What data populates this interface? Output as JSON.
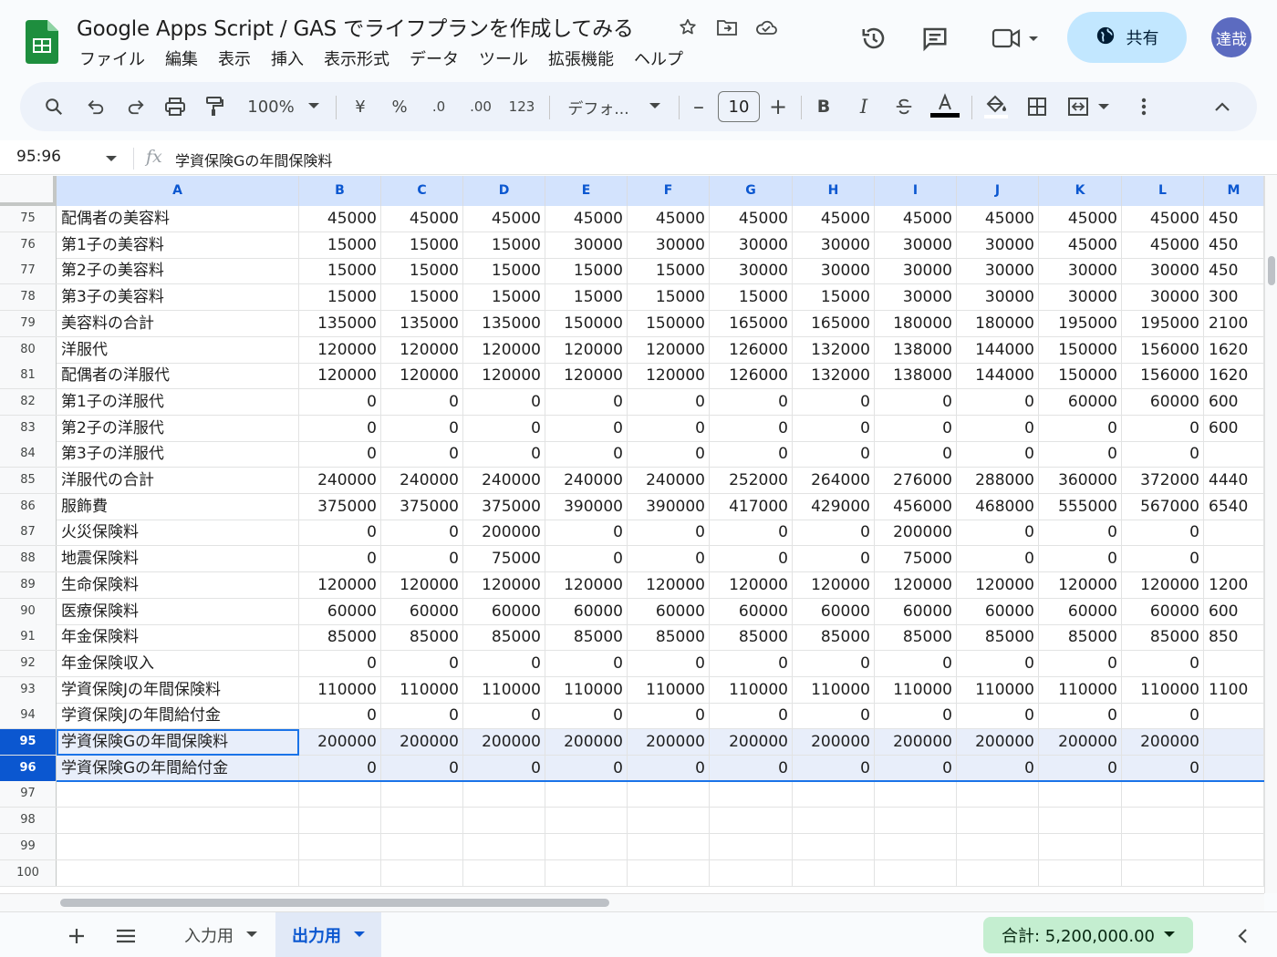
{
  "doc": {
    "title": "Google Apps Script / GAS でライフプランを作成してみる",
    "menu": [
      "ファイル",
      "編集",
      "表示",
      "挿入",
      "表示形式",
      "データ",
      "ツール",
      "拡張機能",
      "ヘルプ"
    ],
    "share_label": "共有",
    "avatar_text": "達哉"
  },
  "toolbar": {
    "zoom": "100%",
    "currency": "¥",
    "percent": "%",
    "dec_minus": ".0",
    "dec_plus": ".00",
    "format_123": "123",
    "font": "デフォ...",
    "font_size": "10"
  },
  "formula_bar": {
    "name_box": "95:96",
    "fx": "fx",
    "content": "学資保険Gの年間保険料"
  },
  "grid": {
    "columns": [
      "A",
      "B",
      "C",
      "D",
      "E",
      "F",
      "G",
      "H",
      "I",
      "J",
      "K",
      "L",
      "M"
    ],
    "rows": [
      {
        "num": "75",
        "label": "配偶者の美容料",
        "values": [
          "45000",
          "45000",
          "45000",
          "45000",
          "45000",
          "45000",
          "45000",
          "45000",
          "45000",
          "45000",
          "45000",
          "450"
        ]
      },
      {
        "num": "76",
        "label": "第1子の美容料",
        "values": [
          "15000",
          "15000",
          "15000",
          "30000",
          "30000",
          "30000",
          "30000",
          "30000",
          "30000",
          "45000",
          "45000",
          "450"
        ]
      },
      {
        "num": "77",
        "label": "第2子の美容料",
        "values": [
          "15000",
          "15000",
          "15000",
          "15000",
          "15000",
          "30000",
          "30000",
          "30000",
          "30000",
          "30000",
          "30000",
          "450"
        ]
      },
      {
        "num": "78",
        "label": "第3子の美容料",
        "values": [
          "15000",
          "15000",
          "15000",
          "15000",
          "15000",
          "15000",
          "15000",
          "30000",
          "30000",
          "30000",
          "30000",
          "300"
        ]
      },
      {
        "num": "79",
        "label": "美容料の合計",
        "values": [
          "135000",
          "135000",
          "135000",
          "150000",
          "150000",
          "165000",
          "165000",
          "180000",
          "180000",
          "195000",
          "195000",
          "2100"
        ]
      },
      {
        "num": "80",
        "label": "洋服代",
        "values": [
          "120000",
          "120000",
          "120000",
          "120000",
          "120000",
          "126000",
          "132000",
          "138000",
          "144000",
          "150000",
          "156000",
          "1620"
        ]
      },
      {
        "num": "81",
        "label": "配偶者の洋服代",
        "values": [
          "120000",
          "120000",
          "120000",
          "120000",
          "120000",
          "126000",
          "132000",
          "138000",
          "144000",
          "150000",
          "156000",
          "1620"
        ]
      },
      {
        "num": "82",
        "label": "第1子の洋服代",
        "values": [
          "0",
          "0",
          "0",
          "0",
          "0",
          "0",
          "0",
          "0",
          "0",
          "60000",
          "60000",
          "600"
        ]
      },
      {
        "num": "83",
        "label": "第2子の洋服代",
        "values": [
          "0",
          "0",
          "0",
          "0",
          "0",
          "0",
          "0",
          "0",
          "0",
          "0",
          "0",
          "600"
        ]
      },
      {
        "num": "84",
        "label": "第3子の洋服代",
        "values": [
          "0",
          "0",
          "0",
          "0",
          "0",
          "0",
          "0",
          "0",
          "0",
          "0",
          "0",
          ""
        ]
      },
      {
        "num": "85",
        "label": "洋服代の合計",
        "values": [
          "240000",
          "240000",
          "240000",
          "240000",
          "240000",
          "252000",
          "264000",
          "276000",
          "288000",
          "360000",
          "372000",
          "4440"
        ]
      },
      {
        "num": "86",
        "label": "服飾費",
        "values": [
          "375000",
          "375000",
          "375000",
          "390000",
          "390000",
          "417000",
          "429000",
          "456000",
          "468000",
          "555000",
          "567000",
          "6540"
        ]
      },
      {
        "num": "87",
        "label": "火災保険料",
        "values": [
          "0",
          "0",
          "200000",
          "0",
          "0",
          "0",
          "0",
          "200000",
          "0",
          "0",
          "0",
          ""
        ]
      },
      {
        "num": "88",
        "label": "地震保険料",
        "values": [
          "0",
          "0",
          "75000",
          "0",
          "0",
          "0",
          "0",
          "75000",
          "0",
          "0",
          "0",
          ""
        ]
      },
      {
        "num": "89",
        "label": "生命保険料",
        "values": [
          "120000",
          "120000",
          "120000",
          "120000",
          "120000",
          "120000",
          "120000",
          "120000",
          "120000",
          "120000",
          "120000",
          "1200"
        ]
      },
      {
        "num": "90",
        "label": "医療保険料",
        "values": [
          "60000",
          "60000",
          "60000",
          "60000",
          "60000",
          "60000",
          "60000",
          "60000",
          "60000",
          "60000",
          "60000",
          "600"
        ]
      },
      {
        "num": "91",
        "label": "年金保険料",
        "values": [
          "85000",
          "85000",
          "85000",
          "85000",
          "85000",
          "85000",
          "85000",
          "85000",
          "85000",
          "85000",
          "85000",
          "850"
        ]
      },
      {
        "num": "92",
        "label": "年金保険収入",
        "values": [
          "0",
          "0",
          "0",
          "0",
          "0",
          "0",
          "0",
          "0",
          "0",
          "0",
          "0",
          ""
        ]
      },
      {
        "num": "93",
        "label": "学資保険Jの年間保険料",
        "values": [
          "110000",
          "110000",
          "110000",
          "110000",
          "110000",
          "110000",
          "110000",
          "110000",
          "110000",
          "110000",
          "110000",
          "1100"
        ]
      },
      {
        "num": "94",
        "label": "学資保険Jの年間給付金",
        "values": [
          "0",
          "0",
          "0",
          "0",
          "0",
          "0",
          "0",
          "0",
          "0",
          "0",
          "0",
          ""
        ]
      },
      {
        "num": "95",
        "label": "学資保険Gの年間保険料",
        "values": [
          "200000",
          "200000",
          "200000",
          "200000",
          "200000",
          "200000",
          "200000",
          "200000",
          "200000",
          "200000",
          "200000",
          ""
        ]
      },
      {
        "num": "96",
        "label": "学資保険Gの年間給付金",
        "values": [
          "0",
          "0",
          "0",
          "0",
          "0",
          "0",
          "0",
          "0",
          "0",
          "0",
          "0",
          ""
        ]
      },
      {
        "num": "97",
        "label": "",
        "values": [
          "",
          "",
          "",
          "",
          "",
          "",
          "",
          "",
          "",
          "",
          "",
          ""
        ]
      },
      {
        "num": "98",
        "label": "",
        "values": [
          "",
          "",
          "",
          "",
          "",
          "",
          "",
          "",
          "",
          "",
          "",
          ""
        ]
      },
      {
        "num": "99",
        "label": "",
        "values": [
          "",
          "",
          "",
          "",
          "",
          "",
          "",
          "",
          "",
          "",
          "",
          ""
        ]
      },
      {
        "num": "100",
        "label": "",
        "values": [
          "",
          "",
          "",
          "",
          "",
          "",
          "",
          "",
          "",
          "",
          "",
          ""
        ]
      }
    ],
    "selected_rows": [
      "95",
      "96"
    ]
  },
  "tabs": {
    "sheets": [
      "入力用",
      "出力用"
    ],
    "active": "出力用",
    "sum": "合計: 5,200,000.00"
  },
  "colors": {
    "accent": "#0b57d0",
    "share_bg": "#c2e7ff",
    "selection_bg": "#e8eefa",
    "sum_chip_bg": "#c4eed0",
    "sheets_green": "#188038"
  },
  "icons": [
    "sheets-logo",
    "star-icon",
    "move-folder-icon",
    "cloud-status-icon",
    "history-icon",
    "comment-icon",
    "meet-icon",
    "globe-icon",
    "search-icon",
    "undo-icon",
    "redo-icon",
    "print-icon",
    "paint-format-icon",
    "bold-icon",
    "italic-icon",
    "strikethrough-icon",
    "text-color-icon",
    "fill-color-icon",
    "borders-icon",
    "merge-icon",
    "more-vert-icon",
    "collapse-icon",
    "add-sheet-icon",
    "all-sheets-icon"
  ]
}
